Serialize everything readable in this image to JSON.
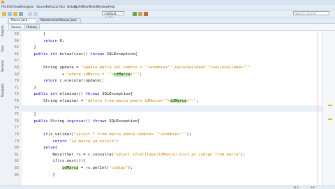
{
  "window": {
    "title": ""
  },
  "menu": [
    "File",
    "Edit",
    "View",
    "Navigate",
    "Source",
    "Refactor",
    "Run",
    "Debug",
    "Profile",
    "Team",
    "Tools",
    "Window",
    "Help"
  ],
  "toolbar": {
    "config": "<default config>",
    "search_placeholder": "Search (Ctrl+I)"
  },
  "left_panels": [
    "Projects",
    "Files",
    "Services",
    "Navigator"
  ],
  "tabs": [
    {
      "label": "Marca.java"
    },
    {
      "label": "MantenedorMarcas.java"
    }
  ],
  "subtabs": {
    "source": "Source",
    "history": "History"
  },
  "code": [
    {
      "n": "63",
      "parts": [
        {
          "t": "        }"
        }
      ]
    },
    {
      "n": "64",
      "parts": [
        {
          "t": "        "
        },
        {
          "t": "return",
          "c": "kw"
        },
        {
          "t": " 0;"
        }
      ]
    },
    {
      "n": "65",
      "parts": [
        {
          "t": "    }"
        }
      ]
    },
    {
      "n": "66",
      "parts": [
        {
          "t": "    "
        },
        {
          "t": "public int",
          "c": "kw"
        },
        {
          "t": " Actualizar() "
        },
        {
          "t": "throws",
          "c": "kw"
        },
        {
          "t": " SQLException{"
        }
      ]
    },
    {
      "n": "67",
      "parts": [
        {
          "t": ""
        }
      ]
    },
    {
      "n": "68",
      "parts": [
        {
          "t": "        String update = "
        },
        {
          "t": "\"update marca set nombre = '\"+nombre+\"',nacionalidad='\"+nacionalidad+\"'\"",
          "c": "str"
        }
      ]
    },
    {
      "n": "69",
      "parts": [
        {
          "t": "                + "
        },
        {
          "t": "\"where idMarca = '\"+",
          "c": "str"
        },
        {
          "t": "idMarca",
          "c": "hl"
        },
        {
          "t": "+\"'\"",
          "c": "str"
        },
        {
          "t": ";"
        }
      ]
    },
    {
      "n": "70",
      "parts": [
        {
          "t": "        "
        },
        {
          "t": "return",
          "c": "kw"
        },
        {
          "t": " c.ejecutar(update);"
        }
      ]
    },
    {
      "n": "71",
      "parts": [
        {
          "t": "    }"
        }
      ]
    },
    {
      "n": "72",
      "parts": [
        {
          "t": "    "
        },
        {
          "t": "public int",
          "c": "kw"
        },
        {
          "t": " eliminar() "
        },
        {
          "t": "throws",
          "c": "kw"
        },
        {
          "t": " SQLException{"
        }
      ]
    },
    {
      "n": "73",
      "parts": [
        {
          "t": "        String eliminar = "
        },
        {
          "t": "\"delete from marca where idMarca='\"+",
          "c": "str"
        },
        {
          "t": "idMarca",
          "c": "hl"
        },
        {
          "t": "+\"'\"",
          "c": "str"
        },
        {
          "t": ";"
        }
      ]
    },
    {
      "n": "74",
      "parts": [
        {
          "t": ""
        }
      ],
      "current": true
    },
    {
      "n": "75",
      "parts": [
        {
          "t": "    }"
        }
      ]
    },
    {
      "n": "76",
      "parts": [
        {
          "t": "    "
        },
        {
          "t": "public",
          "c": "kw"
        },
        {
          "t": " String "
        },
        {
          "t": "ingresar",
          "c": "kw"
        },
        {
          "t": "() "
        },
        {
          "t": "throws",
          "c": "kw"
        },
        {
          "t": " SQLException{"
        }
      ]
    },
    {
      "n": "77",
      "parts": [
        {
          "t": ""
        }
      ]
    },
    {
      "n": "78",
      "parts": [
        {
          "t": "        "
        },
        {
          "t": "if",
          "c": "kw"
        },
        {
          "t": "(c.validar("
        },
        {
          "t": "\"select * from marca where nombre= '\"+nombre+\"'\"",
          "c": "str"
        },
        {
          "t": "))"
        }
      ]
    },
    {
      "n": "79",
      "parts": [
        {
          "t": "            "
        },
        {
          "t": "return",
          "c": "kw"
        },
        {
          "t": " "
        },
        {
          "t": "\"La marca ya existe\"",
          "c": "str"
        },
        {
          "t": ";"
        }
      ]
    },
    {
      "n": "80",
      "parts": [
        {
          "t": "        }"
        },
        {
          "t": "else",
          "c": "kw"
        },
        {
          "t": "{"
        }
      ]
    },
    {
      "n": "81",
      "parts": [
        {
          "t": "            ResultSet rs = c.consulta("
        },
        {
          "t": "\"select ifnull(max(idMarca),0)+1 as codigo from marca\"",
          "c": "str"
        },
        {
          "t": ");"
        }
      ]
    },
    {
      "n": "82",
      "parts": [
        {
          "t": "            "
        },
        {
          "t": "if",
          "c": "kw"
        },
        {
          "t": "(rs.next()){"
        }
      ]
    },
    {
      "n": "83",
      "parts": [
        {
          "t": "                "
        },
        {
          "t": "idMarca",
          "c": "hl"
        },
        {
          "t": " = rs.getInt("
        },
        {
          "t": "\"codigo\"",
          "c": "str"
        },
        {
          "t": ");"
        }
      ]
    },
    {
      "n": "84",
      "parts": [
        {
          "t": "            }"
        }
      ]
    }
  ],
  "status": {
    "position": "74:5",
    "mode": "INS"
  },
  "colors": {
    "keyword": "#0000e6",
    "string": "#ce7b00",
    "highlight": "#c8f0b0"
  }
}
